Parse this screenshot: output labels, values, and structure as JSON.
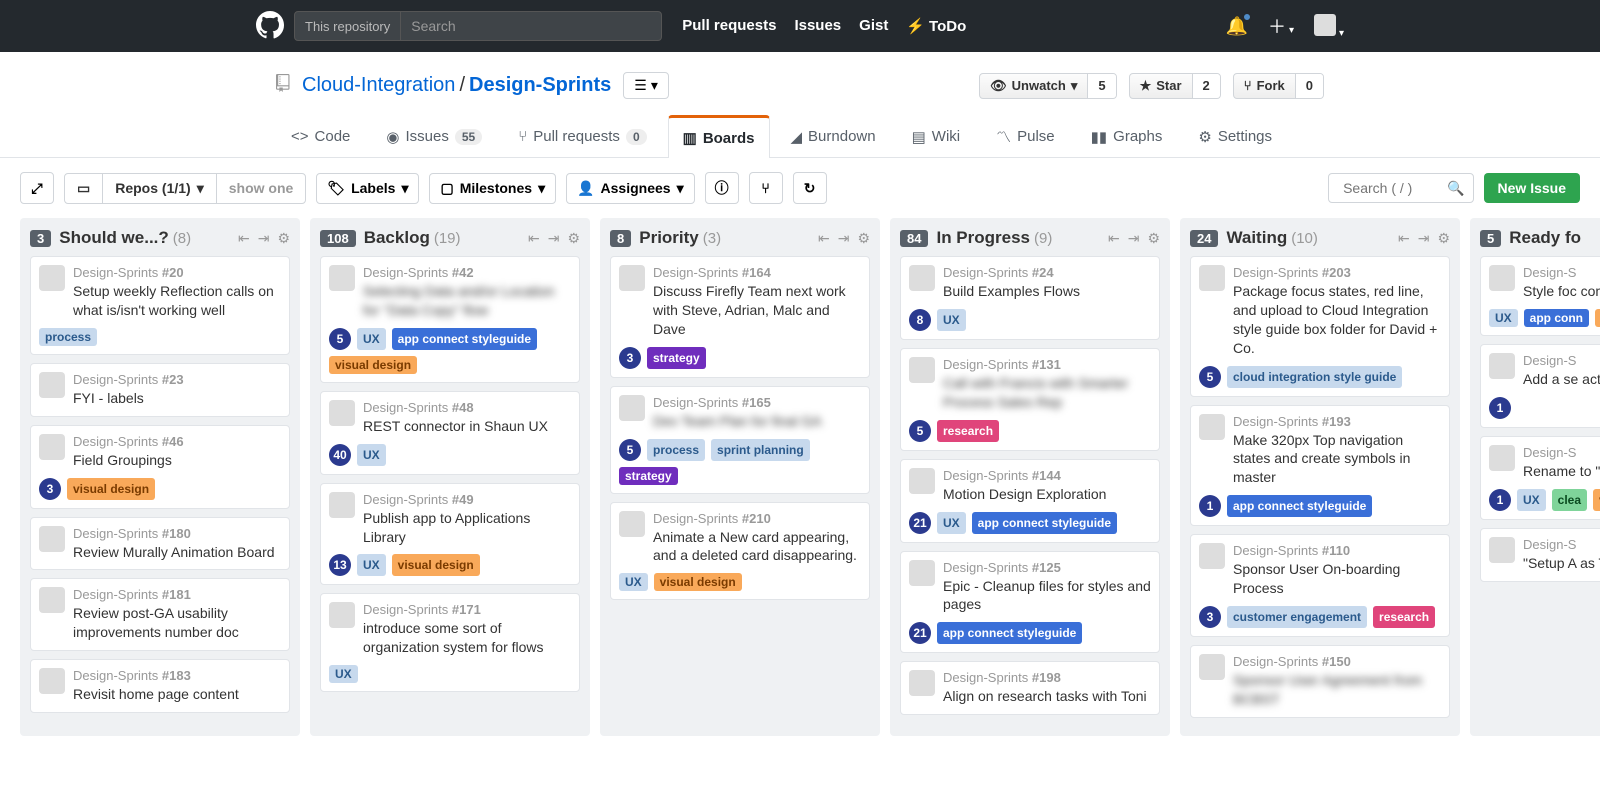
{
  "nav": {
    "search_scope": "This repository",
    "search_placeholder": "Search",
    "links": {
      "pulls": "Pull requests",
      "issues": "Issues",
      "gist": "Gist",
      "todo": "ToDo"
    }
  },
  "repo": {
    "owner": "Cloud-Integration",
    "name": "Design-Sprints",
    "unwatch": {
      "label": "Unwatch",
      "count": 5
    },
    "star": {
      "label": "Star",
      "count": 2
    },
    "fork": {
      "label": "Fork",
      "count": 0
    }
  },
  "tabs": {
    "code": "Code",
    "issues": "Issues",
    "issues_count": 55,
    "pulls": "Pull requests",
    "pulls_count": 0,
    "boards": "Boards",
    "burndown": "Burndown",
    "wiki": "Wiki",
    "pulse": "Pulse",
    "graphs": "Graphs",
    "settings": "Settings"
  },
  "toolbar": {
    "repos": "Repos (1/1)",
    "show_one": "show one",
    "labels": "Labels",
    "milestones": "Milestones",
    "assignees": "Assignees",
    "search_placeholder": "Search ( / )",
    "new_issue": "New Issue"
  },
  "columns": [
    {
      "count": 3,
      "title": "Should we...?",
      "sub": "(8)",
      "cards": [
        {
          "repo": "Design-Sprints",
          "num": "#20",
          "title": "Setup weekly Reflection calls on what is/isn't working well",
          "badge": null,
          "labels": [
            {
              "t": "process",
              "cls": "lbl-process"
            }
          ]
        },
        {
          "repo": "Design-Sprints",
          "num": "#23",
          "title": "FYI - labels"
        },
        {
          "repo": "Design-Sprints",
          "num": "#46",
          "title": "Field Groupings",
          "badge": 3,
          "labels": [
            {
              "t": "visual design",
              "cls": "lbl-vd"
            }
          ]
        },
        {
          "repo": "Design-Sprints",
          "num": "#180",
          "title": "Review Murally Animation Board"
        },
        {
          "repo": "Design-Sprints",
          "num": "#181",
          "title": "Review post-GA usability improvements number doc"
        },
        {
          "repo": "Design-Sprints",
          "num": "#183",
          "title": "Revisit home page content"
        }
      ]
    },
    {
      "count": 108,
      "title": "Backlog",
      "sub": "(19)",
      "cards": [
        {
          "repo": "Design-Sprints",
          "num": "#42",
          "title": "Selecting Data and/or Location for \"Data Copy\" flow",
          "blur": true,
          "badge": 5,
          "labels": [
            {
              "t": "UX",
              "cls": "lbl-ux"
            },
            {
              "t": "app connect styleguide",
              "cls": "lbl-acg"
            },
            {
              "t": "visual design",
              "cls": "lbl-vd"
            }
          ]
        },
        {
          "repo": "Design-Sprints",
          "num": "#48",
          "title": "REST connector in Shaun UX",
          "badge": 40,
          "labels": [
            {
              "t": "UX",
              "cls": "lbl-ux"
            }
          ]
        },
        {
          "repo": "Design-Sprints",
          "num": "#49",
          "title": "Publish app to Applications Library",
          "badge": 13,
          "labels": [
            {
              "t": "UX",
              "cls": "lbl-ux"
            },
            {
              "t": "visual design",
              "cls": "lbl-vd"
            }
          ]
        },
        {
          "repo": "Design-Sprints",
          "num": "#171",
          "title": "introduce some sort of organization system for flows",
          "labels": [
            {
              "t": "UX",
              "cls": "lbl-ux"
            }
          ]
        }
      ]
    },
    {
      "count": 8,
      "title": "Priority",
      "sub": "(3)",
      "cards": [
        {
          "repo": "Design-Sprints",
          "num": "#164",
          "title": "Discuss Firefly Team next work with Steve, Adrian, Malc and Dave",
          "badge": 3,
          "labels": [
            {
              "t": "strategy",
              "cls": "lbl-strategy"
            }
          ]
        },
        {
          "repo": "Design-Sprints",
          "num": "#165",
          "title": "Dev Team Plan for final GA",
          "blur": true,
          "badge": 5,
          "labels": [
            {
              "t": "process",
              "cls": "lbl-process"
            },
            {
              "t": "sprint planning",
              "cls": "lbl-sprint"
            },
            {
              "t": "strategy",
              "cls": "lbl-strategy"
            }
          ]
        },
        {
          "repo": "Design-Sprints",
          "num": "#210",
          "title": "Animate a New card appearing, and a deleted card disappearing.",
          "labels": [
            {
              "t": "UX",
              "cls": "lbl-ux"
            },
            {
              "t": "visual design",
              "cls": "lbl-vd"
            }
          ]
        }
      ]
    },
    {
      "count": 84,
      "title": "In Progress",
      "sub": "(9)",
      "cards": [
        {
          "repo": "Design-Sprints",
          "num": "#24",
          "title": "Build Examples Flows",
          "badge": 8,
          "labels": [
            {
              "t": "UX",
              "cls": "lbl-ux"
            }
          ]
        },
        {
          "repo": "Design-Sprints",
          "num": "#131",
          "title": "Call with Francis with Smarter Process Sales Rep",
          "blur": true,
          "badge": 5,
          "labels": [
            {
              "t": "research",
              "cls": "lbl-research"
            }
          ]
        },
        {
          "repo": "Design-Sprints",
          "num": "#144",
          "title": "Motion Design Exploration",
          "badge": 21,
          "labels": [
            {
              "t": "UX",
              "cls": "lbl-ux"
            },
            {
              "t": "app connect styleguide",
              "cls": "lbl-acg"
            }
          ]
        },
        {
          "repo": "Design-Sprints",
          "num": "#125",
          "title": "Epic - Cleanup files for styles and pages",
          "badge": 21,
          "labels": [
            {
              "t": "app connect styleguide",
              "cls": "lbl-acg"
            }
          ]
        },
        {
          "repo": "Design-Sprints",
          "num": "#198",
          "title": "Align on research tasks with Toni"
        }
      ]
    },
    {
      "count": 24,
      "title": "Waiting",
      "sub": "(10)",
      "cards": [
        {
          "repo": "Design-Sprints",
          "num": "#203",
          "title": "Package focus states, red line, and upload to Cloud Integration style guide box folder for David + Co.",
          "badge": 5,
          "labels": [
            {
              "t": "cloud integration style guide",
              "cls": "lbl-cloud"
            }
          ]
        },
        {
          "repo": "Design-Sprints",
          "num": "#193",
          "title": "Make 320px Top navigation states and create symbols in master",
          "badge": 1,
          "labels": [
            {
              "t": "app connect styleguide",
              "cls": "lbl-acg"
            }
          ]
        },
        {
          "repo": "Design-Sprints",
          "num": "#110",
          "title": "Sponsor User On-boarding Process",
          "badge": 3,
          "labels": [
            {
              "t": "customer engagement",
              "cls": "lbl-ce"
            },
            {
              "t": "research",
              "cls": "lbl-research"
            }
          ]
        },
        {
          "repo": "Design-Sprints",
          "num": "#150",
          "title": "Sponsor User Agreement from BCBST",
          "blur": true
        }
      ]
    },
    {
      "count": 5,
      "title": "Ready fo",
      "sub": "",
      "cards": [
        {
          "repo": "Design-S",
          "num": "",
          "title": "Style foc compone",
          "labels": [
            {
              "t": "UX",
              "cls": "lbl-ux"
            },
            {
              "t": "app conn",
              "cls": "lbl-acg"
            },
            {
              "t": "visual design",
              "cls": "lbl-vd"
            }
          ]
        },
        {
          "repo": "Design-S",
          "num": "",
          "title": "Add a se action to",
          "badge": 1
        },
        {
          "repo": "Design-S",
          "num": "",
          "title": "Rename to \"Auto t",
          "badge": 1,
          "labels": [
            {
              "t": "UX",
              "cls": "lbl-ux"
            },
            {
              "t": "clea",
              "cls": "lbl-clea"
            },
            {
              "t": "visual design",
              "cls": "lbl-vd"
            }
          ]
        },
        {
          "repo": "Design-S",
          "num": "",
          "title": "\"Setup A as Targe"
        }
      ]
    }
  ]
}
